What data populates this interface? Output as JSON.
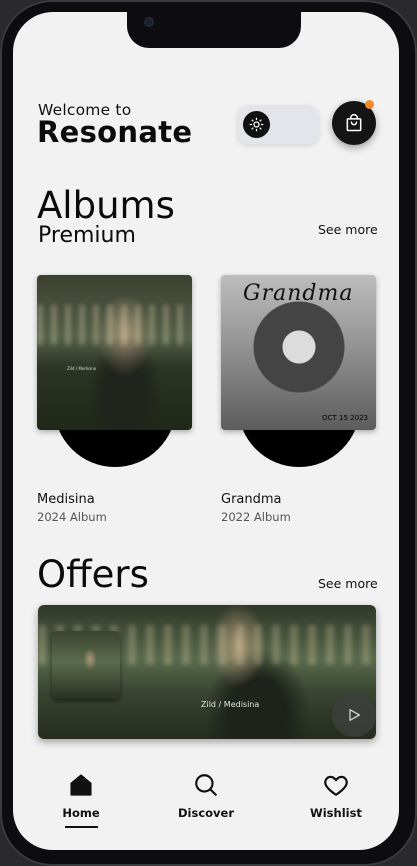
{
  "header": {
    "welcome": "Welcome to",
    "app_name": "Resonate"
  },
  "toggle": {
    "icon": "sun-icon"
  },
  "cart": {
    "icon": "shopping-bag-icon",
    "has_notification": true,
    "dot_color": "#f08a2b"
  },
  "albums_section": {
    "title": "Albums",
    "subtitle": "Premium",
    "see_more": "See more",
    "items": [
      {
        "name": "Medisina",
        "meta": "2024 Album",
        "cover_text": "Zild / Medisina"
      },
      {
        "name": "Grandma",
        "meta": "2022 Album",
        "cover_text": "Grandma",
        "cover_bottom": "OCT 15 2023"
      }
    ]
  },
  "offers_section": {
    "title": "Offers",
    "see_more": "See more",
    "card": {
      "caption": "Zild / Medisina",
      "icon": "play-icon"
    }
  },
  "nav": {
    "items": [
      {
        "label": "Home",
        "icon": "home-icon",
        "active": true
      },
      {
        "label": "Discover",
        "icon": "search-icon",
        "active": false
      },
      {
        "label": "Wishlist",
        "icon": "heart-icon",
        "active": false
      }
    ]
  }
}
